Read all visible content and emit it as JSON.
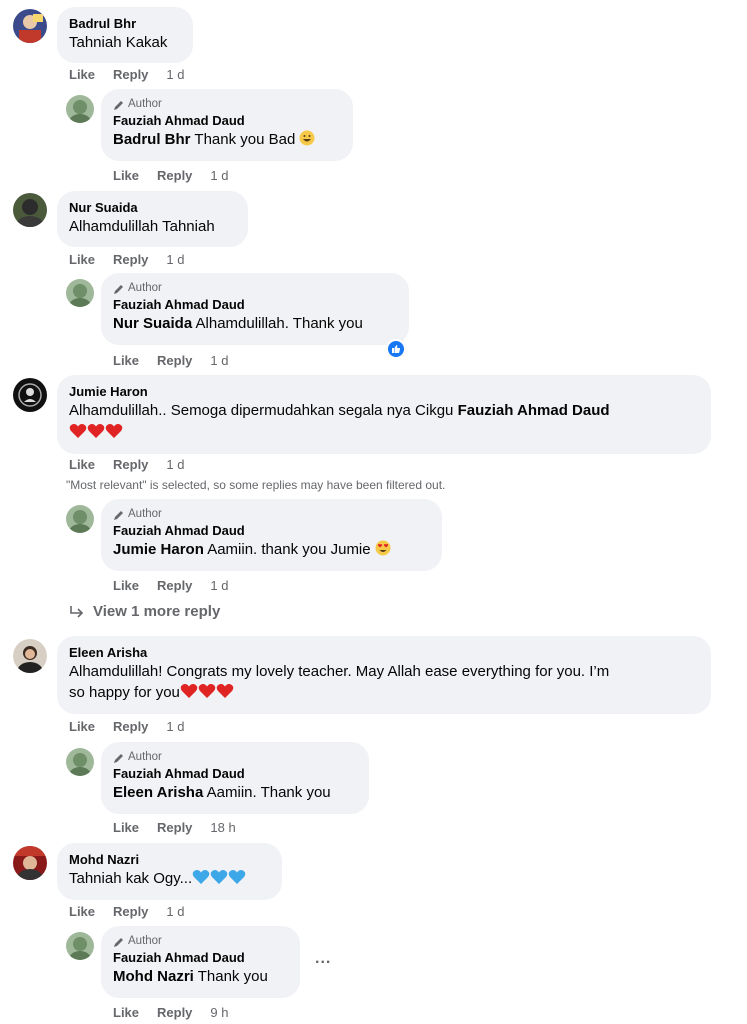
{
  "labels": {
    "like": "Like",
    "reply": "Reply",
    "author": "Author"
  },
  "comments": [
    {
      "name": "Badrul Bhr",
      "text": "Tahniah Kakak",
      "time": "1 d",
      "reply": {
        "name": "Fauziah Ahmad Daud",
        "mention": "Badrul Bhr",
        "text": " Thank you Bad",
        "time": "1 d"
      }
    },
    {
      "name": "Nur Suaida",
      "text": "Alhamdulillah Tahniah",
      "time": "1 d",
      "reply": {
        "name": "Fauziah Ahmad Daud",
        "mention": "Nur Suaida",
        "text": " Alhamdulillah. Thank you",
        "time": "1 d"
      }
    },
    {
      "name": "Jumie Haron",
      "text": "Alhamdulillah.. Semoga dipermudahkan segala nya Cikgu ",
      "mention": "Fauziah Ahmad Daud",
      "time": "1 d",
      "filter_note": "\"Most relevant\" is selected, so some replies may have been filtered out.",
      "reply": {
        "name": "Fauziah Ahmad Daud",
        "mention": "Jumie Haron",
        "text": " Aamiin. thank you Jumie",
        "time": "1 d"
      },
      "view_more": "View 1 more reply"
    },
    {
      "name": "Eleen Arisha",
      "text1": "Alhamdulillah! Congrats my lovely teacher. May Allah ease everything for you. I’m",
      "text2": "so happy for you",
      "time": "1 d",
      "reply": {
        "name": "Fauziah Ahmad Daud",
        "mention": "Eleen Arisha",
        "text": " Aamiin. Thank you",
        "time": "18 h"
      }
    },
    {
      "name": "Mohd Nazri",
      "text": "Tahniah kak Ogy...",
      "time": "1 d",
      "reply": {
        "name": "Fauziah Ahmad Daud",
        "mention": "Mohd Nazri",
        "text": " Thank you",
        "time": "9 h",
        "more": "..."
      }
    }
  ]
}
